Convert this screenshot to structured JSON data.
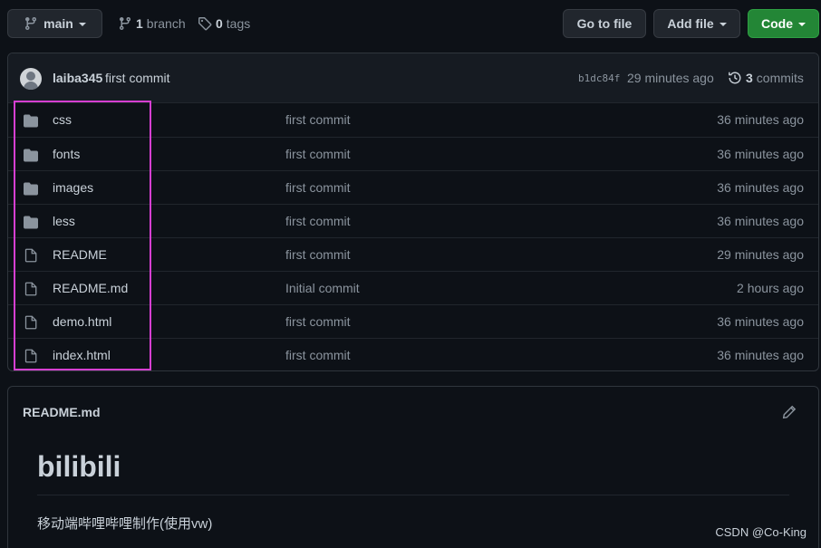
{
  "topbar": {
    "branch_label": "main",
    "branches_count": "1",
    "branches_label": "branch",
    "tags_count": "0",
    "tags_label": "tags",
    "go_to_file": "Go to file",
    "add_file": "Add file",
    "code": "Code"
  },
  "latest_commit": {
    "author": "laiba345",
    "message": "first commit",
    "sha": "b1dc84f",
    "time": "29 minutes ago",
    "commits_count": "3",
    "commits_label": "commits"
  },
  "files": [
    {
      "type": "folder",
      "name": "css",
      "message": "first commit",
      "age": "36 minutes ago"
    },
    {
      "type": "folder",
      "name": "fonts",
      "message": "first commit",
      "age": "36 minutes ago"
    },
    {
      "type": "folder",
      "name": "images",
      "message": "first commit",
      "age": "36 minutes ago"
    },
    {
      "type": "folder",
      "name": "less",
      "message": "first commit",
      "age": "36 minutes ago"
    },
    {
      "type": "file",
      "name": "README",
      "message": "first commit",
      "age": "29 minutes ago"
    },
    {
      "type": "file",
      "name": "README.md",
      "message": "Initial commit",
      "age": "2 hours ago"
    },
    {
      "type": "file",
      "name": "demo.html",
      "message": "first commit",
      "age": "36 minutes ago"
    },
    {
      "type": "file",
      "name": "index.html",
      "message": "first commit",
      "age": "36 minutes ago"
    }
  ],
  "readme": {
    "filename": "README.md",
    "heading": "bilibili",
    "paragraph": "移动端哔哩哔哩制作(使用vw)"
  },
  "watermark": "CSDN @Co-King",
  "colors": {
    "background": "#0d1117",
    "code_button": "#238636",
    "highlight_box": "#d63fd1"
  },
  "icons": [
    "git-branch-icon",
    "branch-icon",
    "tag-icon",
    "history-icon",
    "folder-icon",
    "file-icon",
    "pencil-icon"
  ]
}
